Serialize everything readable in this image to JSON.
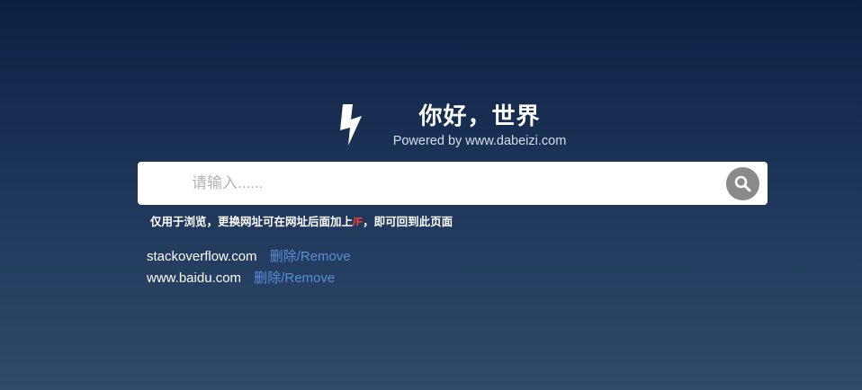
{
  "header": {
    "title": "你好，世界",
    "subtitle": "Powered by www.dabeizi.com",
    "logo_icon": "lightning-bolt-icon"
  },
  "search": {
    "placeholder": "请输入......",
    "value": "",
    "button_icon": "search-icon"
  },
  "hint": {
    "before": "仅用于浏览，更换网址可在网址后面加上",
    "highlight": "/F",
    "after": "，即可回到此页面",
    "highlight_color": "#ff3b30"
  },
  "history": {
    "items": [
      {
        "url": "stackoverflow.com",
        "remove_label": "删除/Remove"
      },
      {
        "url": "www.baidu.com",
        "remove_label": "删除/Remove"
      }
    ]
  },
  "colors": {
    "background_top": "#0c2043",
    "background_bottom": "#2f4a6b",
    "link": "#5a8fd8",
    "search_button": "#8a8a8a"
  }
}
